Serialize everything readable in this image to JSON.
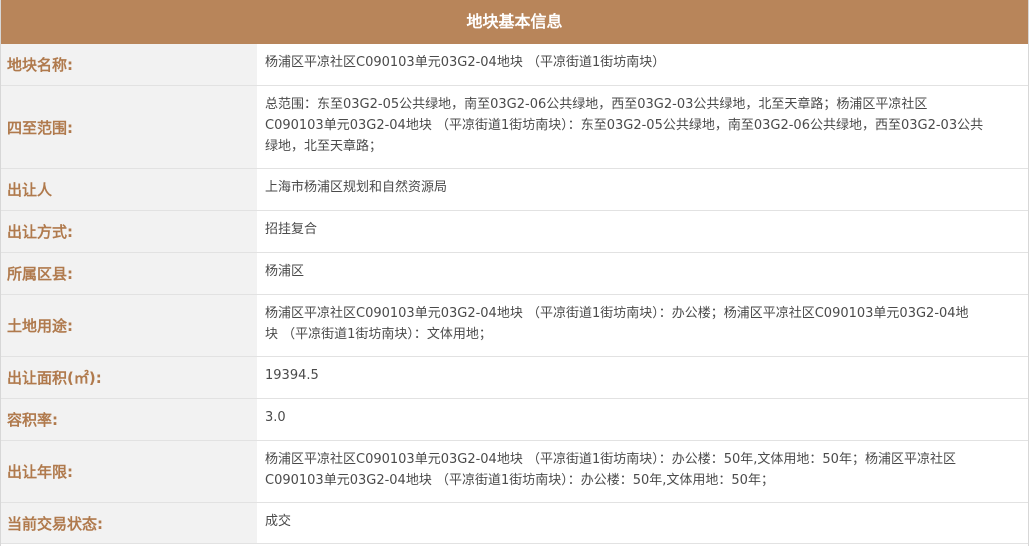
{
  "header": {
    "title": "地块基本信息"
  },
  "rows": [
    {
      "label": "地块名称:",
      "value": "杨浦区平凉社区C090103单元03G2-04地块 （平凉街道1街坊南块）"
    },
    {
      "label": "四至范围:",
      "value": "总范围：东至03G2-05公共绿地，南至03G2-06公共绿地，西至03G2-03公共绿地，北至天章路；杨浦区平凉社区\nC090103单元03G2-04地块 （平凉街道1街坊南块）：东至03G2-05公共绿地，南至03G2-06公共绿地，西至03G2-03公共\n绿地，北至天章路；"
    },
    {
      "label": "出让人",
      "value": "上海市杨浦区规划和自然资源局"
    },
    {
      "label": "出让方式:",
      "value": "招挂复合"
    },
    {
      "label": "所属区县:",
      "value": "杨浦区"
    },
    {
      "label": "土地用途:",
      "value": "杨浦区平凉社区C090103单元03G2-04地块 （平凉街道1街坊南块）：办公楼；杨浦区平凉社区C090103单元03G2-04地\n块 （平凉街道1街坊南块）：文体用地；"
    },
    {
      "label": "出让面积(㎡):",
      "value": "19394.5"
    },
    {
      "label": "容积率:",
      "value": "3.0"
    },
    {
      "label": "出让年限:",
      "value": "杨浦区平凉社区C090103单元03G2-04地块 （平凉街道1街坊南块）：办公楼：50年,文体用地：50年；杨浦区平凉社区\nC090103单元03G2-04地块 （平凉街道1街坊南块）：办公楼：50年,文体用地：50年；"
    },
    {
      "label": "当前交易状态:",
      "value": "成交"
    }
  ]
}
